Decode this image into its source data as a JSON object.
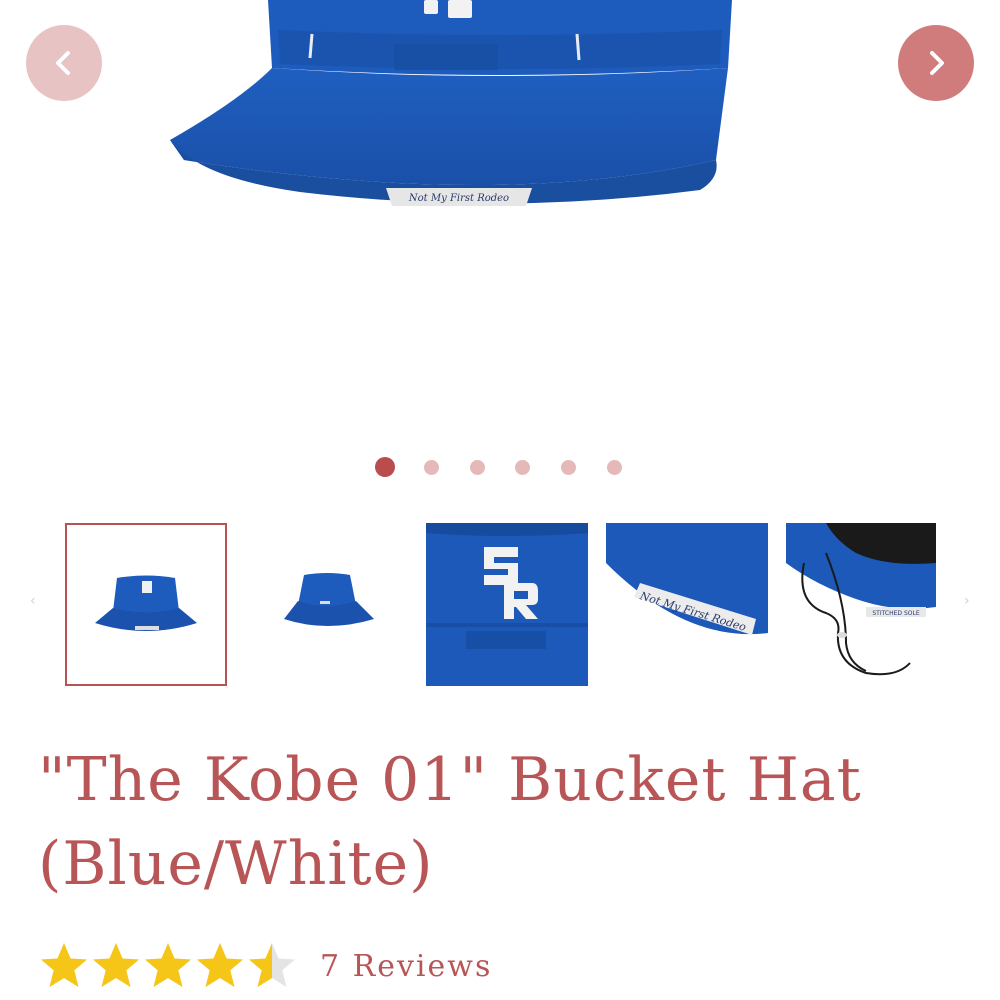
{
  "gallery": {
    "prev_icon": "chevron-left-icon",
    "next_icon": "chevron-right-icon",
    "slide_count": 6,
    "active_slide": 1,
    "hat_label_text": "Not My First Rodeo",
    "thumbnails": [
      {
        "name": "thumb-front-view"
      },
      {
        "name": "thumb-side-view"
      },
      {
        "name": "thumb-logo-closeup"
      },
      {
        "name": "thumb-brim-label-closeup"
      },
      {
        "name": "thumb-underside-strap"
      }
    ],
    "underside_tag_text": "STITCHED SOLE"
  },
  "product": {
    "title": "\"The Kobe 01\" Bucket Hat (Blue/White)",
    "rating": 4.5,
    "rating_max": 5,
    "reviews_label": "7 Reviews"
  },
  "colors": {
    "accent": "#b85556",
    "hat_blue": "#1d5bb8",
    "star_gold": "#f5c518",
    "star_empty": "#e4e4e4"
  }
}
